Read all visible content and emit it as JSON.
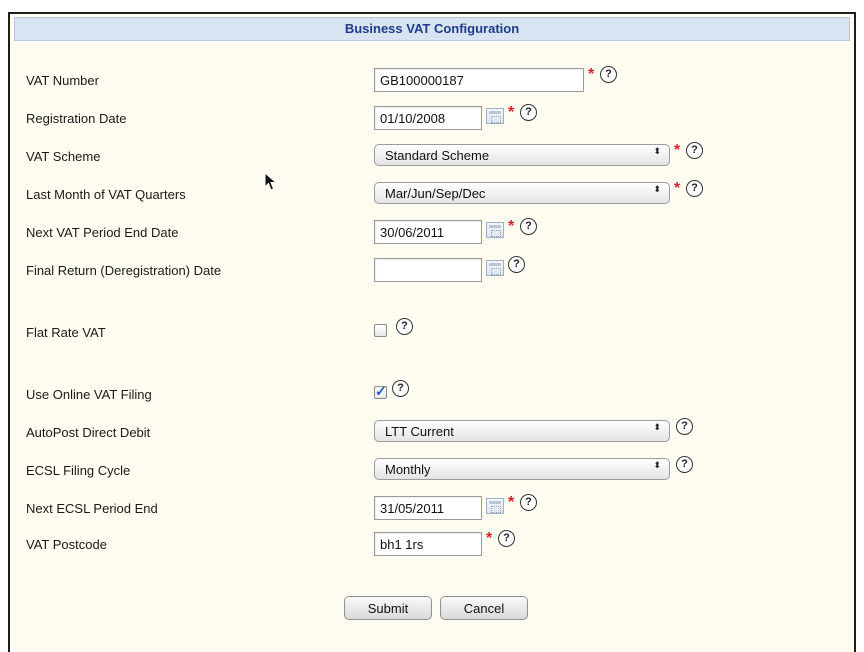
{
  "header": {
    "title": "Business VAT Configuration"
  },
  "fields": {
    "vat_number": {
      "label": "VAT Number",
      "value": "GB100000187"
    },
    "registration_date": {
      "label": "Registration Date",
      "value": "01/10/2008"
    },
    "vat_scheme": {
      "label": "VAT Scheme",
      "value": "Standard Scheme"
    },
    "last_month_quarters": {
      "label": "Last Month of VAT Quarters",
      "value": "Mar/Jun/Sep/Dec"
    },
    "next_period_end": {
      "label": "Next VAT Period End Date",
      "value": "30/06/2011"
    },
    "final_return_date": {
      "label": "Final Return (Deregistration) Date",
      "value": ""
    },
    "flat_rate": {
      "label": "Flat Rate VAT",
      "checked": false
    },
    "online_filing": {
      "label": "Use Online VAT Filing",
      "checked": true
    },
    "autopost_dd": {
      "label": "AutoPost Direct Debit",
      "value": "LTT Current"
    },
    "ecsl_cycle": {
      "label": "ECSL Filing Cycle",
      "value": "Monthly"
    },
    "next_ecsl_end": {
      "label": "Next ECSL Period End",
      "value": "31/05/2011"
    },
    "vat_postcode": {
      "label": "VAT Postcode",
      "value": "bh1 1rs"
    }
  },
  "buttons": {
    "submit": "Submit",
    "cancel": "Cancel"
  },
  "symbols": {
    "required": "*",
    "help": "?",
    "select_arrows": "⬍"
  },
  "colors": {
    "accent": "#1f3b8c",
    "required": "#d9202a",
    "header_bg": "#d8e4f2",
    "panel_bg": "#fffdf1"
  }
}
